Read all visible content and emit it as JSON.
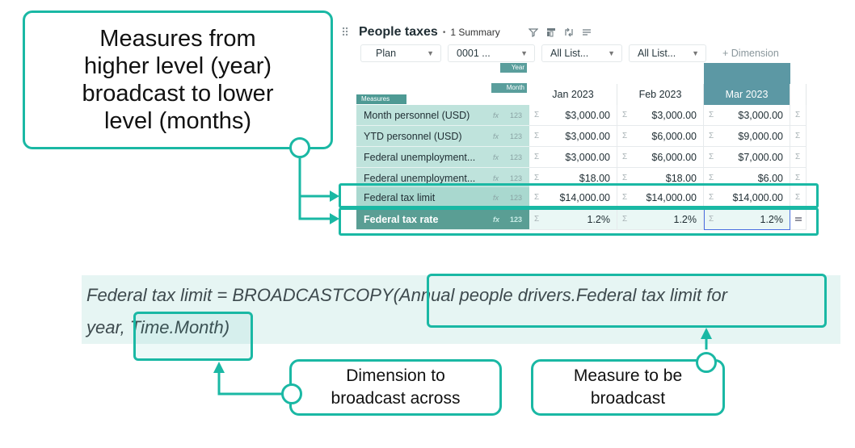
{
  "callouts": {
    "top_lines": [
      "Measures from",
      "higher level (year)",
      "broadcast to lower",
      "level (months)"
    ],
    "dimension_lines": [
      "Dimension to",
      "broadcast across"
    ],
    "measure_lines": [
      "Measure to be",
      "broadcast"
    ]
  },
  "grid": {
    "title": "People taxes",
    "summary": "1 Summary",
    "tool_icons": [
      "filter-icon",
      "column-filter-icon",
      "pivot-icon",
      "menu-icon"
    ],
    "dimensions": [
      {
        "label": "Plan"
      },
      {
        "label": "0001 ..."
      },
      {
        "label": "All List..."
      },
      {
        "label": "All List..."
      }
    ],
    "add_dimension": "+ Dimension",
    "header_labels": {
      "year": "Year",
      "month": "Month",
      "measures": "Measures"
    },
    "months": [
      "Jan 2023",
      "Feb 2023",
      "Mar 2023"
    ],
    "selected_month_index": 2,
    "fx_glyph": "fx",
    "type_glyph": "123",
    "sigma": "Σ",
    "rows": [
      {
        "label": "Month personnel (USD)",
        "values": [
          "$3,000.00",
          "$3,000.00",
          "$3,000.00"
        ]
      },
      {
        "label": "YTD personnel (USD)",
        "values": [
          "$3,000.00",
          "$6,000.00",
          "$9,000.00"
        ]
      },
      {
        "label": "Federal unemployment...",
        "values": [
          "$3,000.00",
          "$6,000.00",
          "$7,000.00"
        ]
      },
      {
        "label": "Federal unemployment...",
        "values": [
          "$18.00",
          "$18.00",
          "$6.00"
        ]
      },
      {
        "label": "Federal tax limit",
        "values": [
          "$14,000.00",
          "$14,000.00",
          "$14,000.00"
        ]
      },
      {
        "label": "Federal tax rate",
        "values": [
          "1.2%",
          "1.2%",
          "1.2%"
        ]
      }
    ]
  },
  "formula": {
    "line1": "Federal tax limit = BROADCASTCOPY(Annual people drivers.Federal tax limit for",
    "line2": "year, Time.Month)"
  },
  "colors": {
    "accent": "#1ab8a4",
    "measure_bg": "#bfe3dc",
    "selected_header": "#5c98a4"
  }
}
